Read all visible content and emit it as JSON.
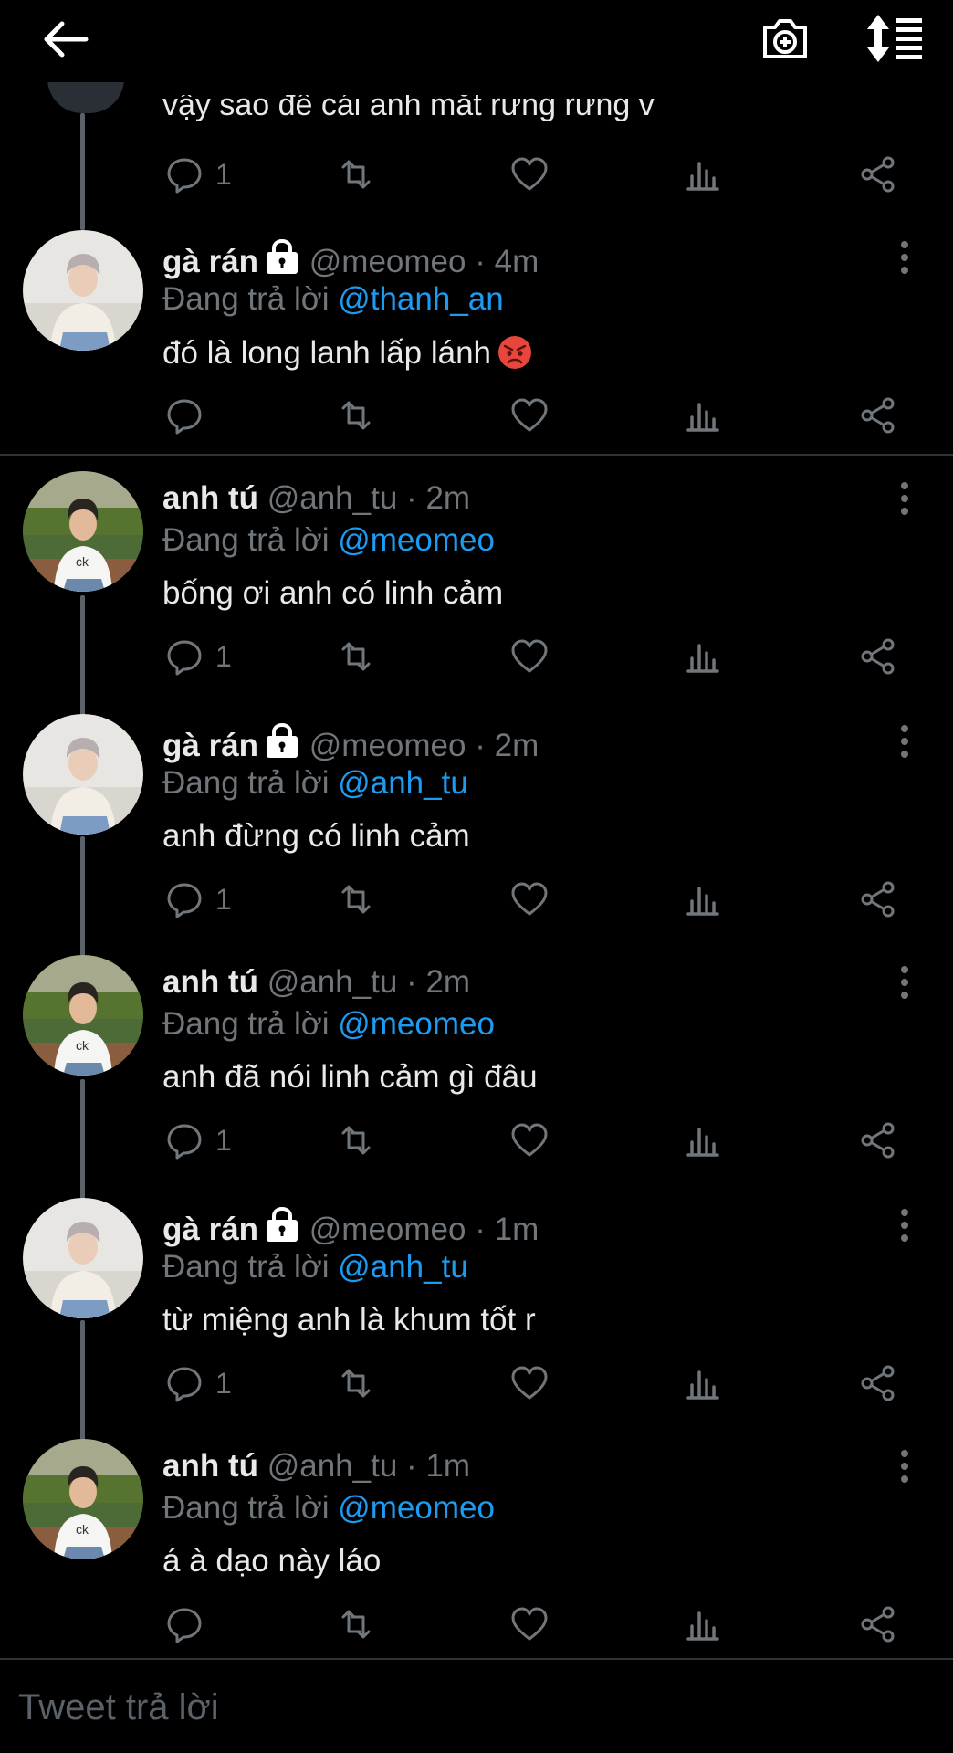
{
  "topbar": {
    "back_icon": "arrow-left-icon",
    "camera_icon": "camera-plus-icon",
    "sort_icon": "sort-list-icon"
  },
  "partial_tweet": {
    "text": "vậy sao để cái anh mắt rưng rưng v",
    "reply_count": "1"
  },
  "tweets": [
    {
      "name": "gà rán",
      "locked": true,
      "handle": "@meomeo",
      "dot": "·",
      "time": "4m",
      "reply_prefix": "Đang trả lời",
      "reply_to": "@thanh_an",
      "text": "đó là long lanh lấp lánh",
      "emoji": "angry-face-emoji",
      "reply_count": ""
    },
    {
      "name": "anh tú",
      "locked": false,
      "handle": "@anh_tu",
      "dot": "·",
      "time": "2m",
      "reply_prefix": "Đang trả lời",
      "reply_to": "@meomeo",
      "text": "bống ơi anh có linh cảm",
      "reply_count": "1"
    },
    {
      "name": "gà rán",
      "locked": true,
      "handle": "@meomeo",
      "dot": "·",
      "time": "2m",
      "reply_prefix": "Đang trả lời",
      "reply_to": "@anh_tu",
      "text": "anh đừng có linh cảm",
      "reply_count": "1"
    },
    {
      "name": "anh tú",
      "locked": false,
      "handle": "@anh_tu",
      "dot": "·",
      "time": "2m",
      "reply_prefix": "Đang trả lời",
      "reply_to": "@meomeo",
      "text": "anh đã nói linh cảm gì đâu",
      "reply_count": "1"
    },
    {
      "name": "gà rán",
      "locked": true,
      "handle": "@meomeo",
      "dot": "·",
      "time": "1m",
      "reply_prefix": "Đang trả lời",
      "reply_to": "@anh_tu",
      "text": "từ miệng anh là khum tốt r",
      "reply_count": "1"
    },
    {
      "name": "anh tú",
      "locked": false,
      "handle": "@anh_tu",
      "dot": "·",
      "time": "1m",
      "reply_prefix": "Đang trả lời",
      "reply_to": "@meomeo",
      "text": "á à dạo này láo",
      "reply_count": ""
    }
  ],
  "reply_box": {
    "placeholder": "Tweet trả lời"
  },
  "colors": {
    "background": "#000000",
    "text": "#e7e9ea",
    "muted": "#71767b",
    "link": "#1d9bf0",
    "divider": "#2f3336"
  }
}
